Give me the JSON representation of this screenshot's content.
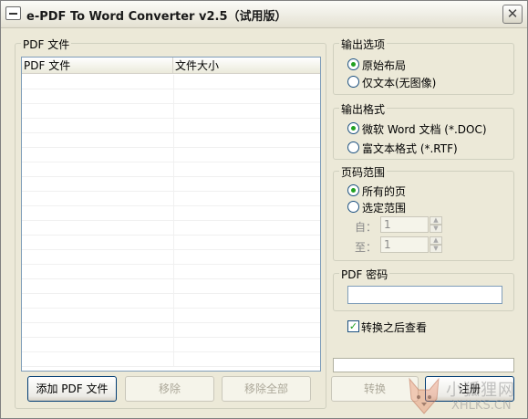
{
  "window": {
    "title": "e-PDF To Word Converter v2.5（试用版）",
    "close_glyph": "✕"
  },
  "files_group": {
    "label": "PDF 文件",
    "columns": [
      "PDF 文件",
      "文件大小"
    ]
  },
  "buttons": {
    "add": "添加 PDF 文件",
    "remove": "移除",
    "remove_all": "移除全部",
    "convert": "转换",
    "register": "注册"
  },
  "output_options": {
    "label": "输出选项",
    "original_layout": "原始布局",
    "text_only": "仅文本(无图像)",
    "selected": "original_layout"
  },
  "output_format": {
    "label": "输出格式",
    "doc": "微软 Word 文档 (*.DOC)",
    "rtf": "富文本格式 (*.RTF)",
    "selected": "doc"
  },
  "page_range": {
    "label": "页码范围",
    "all_pages": "所有的页",
    "select_range": "选定范围",
    "from_label": "自：",
    "to_label": "至：",
    "from_value": "1",
    "to_value": "1",
    "selected": "all_pages"
  },
  "password": {
    "label": "PDF 密码",
    "value": ""
  },
  "view_after": {
    "label": "转换之后查看",
    "checked": true
  },
  "watermark": {
    "line1": "小狐狸网",
    "line2": "XHLKS.CN"
  },
  "colors": {
    "window_bg": "#ece9d8",
    "radio_dot": "#21a121",
    "border_blue": "#7f9db9"
  }
}
